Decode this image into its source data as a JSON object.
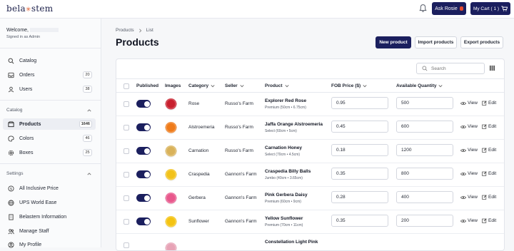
{
  "brand": {
    "logo_left": "bela",
    "logo_right": "stem"
  },
  "topbar": {
    "ask_label": "Ask Rosie",
    "cart_label": "My Cart ( 1 )"
  },
  "sidebar": {
    "welcome": "Welcome,",
    "signed_in": "Signed in as Admin",
    "items": [
      {
        "label": "Catalog",
        "icon": "search-icon",
        "badge": ""
      },
      {
        "label": "Orders",
        "icon": "inbox-icon",
        "badge": "20"
      },
      {
        "label": "Users",
        "icon": "users-icon",
        "badge": "38"
      }
    ],
    "catalog_section": "Catalog",
    "catalog_items": [
      {
        "label": "Products",
        "icon": "box-icon",
        "badge": "1646",
        "active": true
      },
      {
        "label": "Colors",
        "icon": "palette-icon",
        "badge": "46"
      },
      {
        "label": "Boxes",
        "icon": "gear-icon",
        "badge": "25"
      }
    ],
    "settings_section": "Settings",
    "settings_items": [
      {
        "label": "All Inclusive Price",
        "icon": "dollar-icon"
      },
      {
        "label": "UPS World Ease",
        "icon": "globe-icon"
      },
      {
        "label": "Belastem Information",
        "icon": "building-icon"
      },
      {
        "label": "Manage Staff",
        "icon": "staff-icon"
      },
      {
        "label": "My Profile",
        "icon": "profile-icon"
      }
    ]
  },
  "breadcrumb": {
    "root": "Products",
    "current": "List"
  },
  "page_title": "Products",
  "actions": {
    "new": "New product",
    "import": "Import products",
    "export": "Export products"
  },
  "search": {
    "placeholder": "Search"
  },
  "columns": {
    "published": "Published",
    "images": "Images",
    "category": "Category",
    "seller": "Seller",
    "product": "Product",
    "fob": "FOB Price ($)",
    "qty": "Available Quantity"
  },
  "row_actions": {
    "view": "View",
    "edit": "Edit"
  },
  "rows": [
    {
      "category": "Rose",
      "seller": "Russo's Farm",
      "product": "Explorer Red Rose",
      "variant": "Premium (50cm • 6.75cm)",
      "fob": "0.95",
      "qty": "500",
      "color": "#c8202e"
    },
    {
      "category": "Alstroemeria",
      "seller": "Russo's Farm",
      "product": "Jaffa Orange Alstroemeria",
      "variant": "Select (60cm • 5cm)",
      "fob": "0.45",
      "qty": "600",
      "color": "#ef7b1a"
    },
    {
      "category": "Carnation",
      "seller": "Russo's Farm",
      "product": "Carnation Honey",
      "variant": "Select (70cm • 4.5cm)",
      "fob": "0.18",
      "qty": "1200",
      "color": "#d9b25a"
    },
    {
      "category": "Craspedia",
      "seller": "Gannon's Farm",
      "product": "Craspedia Billy Balls",
      "variant": "Jumbo (40cm • 3.65cm)",
      "fob": "0.35",
      "qty": "800",
      "color": "#f2c21a"
    },
    {
      "category": "Gerbera",
      "seller": "Gannon's Farm",
      "product": "Pink Gerbera Daisy",
      "variant": "Premium (60cm • 9cm)",
      "fob": "0.28",
      "qty": "400",
      "color": "#e8588c"
    },
    {
      "category": "Sunflower",
      "seller": "Gannon's Farm",
      "product": "Yellow Sunflower",
      "variant": "Premium (70cm • 11cm)",
      "fob": "0.35",
      "qty": "200",
      "color": "#f4c312"
    },
    {
      "category": "",
      "seller": "",
      "product": "Constellation Light Pink",
      "variant": "",
      "fob": "",
      "qty": "",
      "color": "#e7a3b6"
    }
  ]
}
